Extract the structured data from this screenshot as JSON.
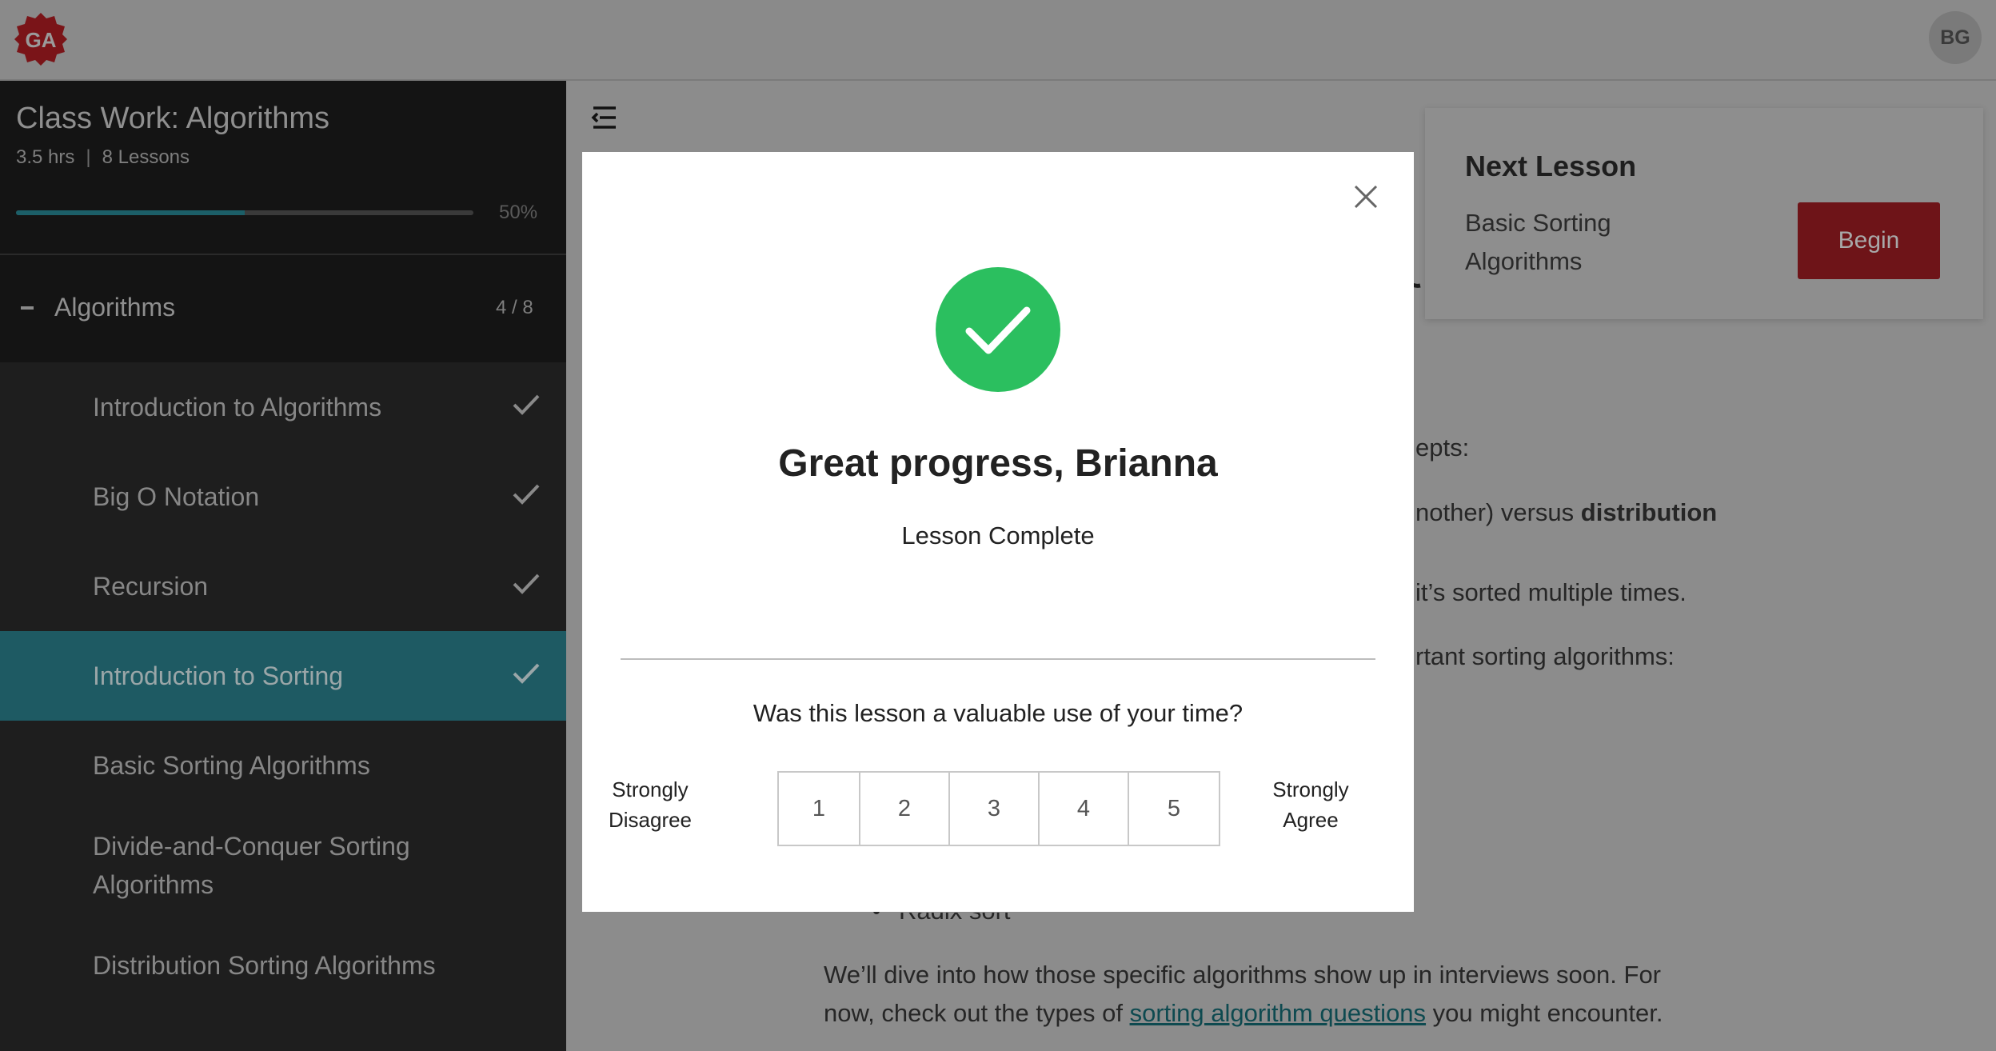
{
  "header": {
    "logo_text": "GA",
    "avatar_initials": "BG"
  },
  "sidebar": {
    "course_title": "Class Work: Algorithms",
    "duration": "3.5 hrs",
    "lesson_count": "8 Lessons",
    "progress_label": "50%",
    "progress_value": 0.5,
    "section": {
      "title": "Algorithms",
      "count": "4 / 8"
    },
    "lessons": [
      {
        "label": "Introduction to Algorithms",
        "completed": true
      },
      {
        "label": "Big O Notation",
        "completed": true
      },
      {
        "label": "Recursion",
        "completed": true
      },
      {
        "label": "Introduction to Sorting",
        "completed": true,
        "active": true
      },
      {
        "label": "Basic Sorting Algorithms",
        "completed": false
      },
      {
        "label": "Divide-and-Conquer Sorting Algorithms",
        "completed": false
      },
      {
        "label": "Distribution Sorting Algorithms",
        "completed": false
      }
    ]
  },
  "next_lesson": {
    "heading": "Next Lesson",
    "title": "Basic Sorting Algorithms",
    "button_label": "Begin"
  },
  "background_content": {
    "line1": "epts:",
    "line2_prefix": "nother) versus ",
    "line2_bold": "distribution",
    "line3": "it’s sorted multiple times.",
    "line4": "rtant sorting algorithms:",
    "bullet_partial": "Radix sort",
    "para_line1": "We’ll dive into how those specific algorithms show up in interviews soon. For",
    "para_line2_prefix": "now, check out the types of ",
    "para_link": "sorting algorithm questions",
    "para_line2_suffix": " you might encounter."
  },
  "modal": {
    "title": "Great progress, Brianna",
    "subtitle": "Lesson Complete",
    "question": "Was this lesson a valuable use of your time?",
    "scale_low": "Strongly Disagree",
    "scale_high": "Strongly Agree",
    "ratings": [
      "1",
      "2",
      "3",
      "4",
      "5"
    ]
  },
  "colors": {
    "brand_red": "#c8202a",
    "success_green": "#2bbf5f",
    "active_teal": "#1e5a63"
  }
}
